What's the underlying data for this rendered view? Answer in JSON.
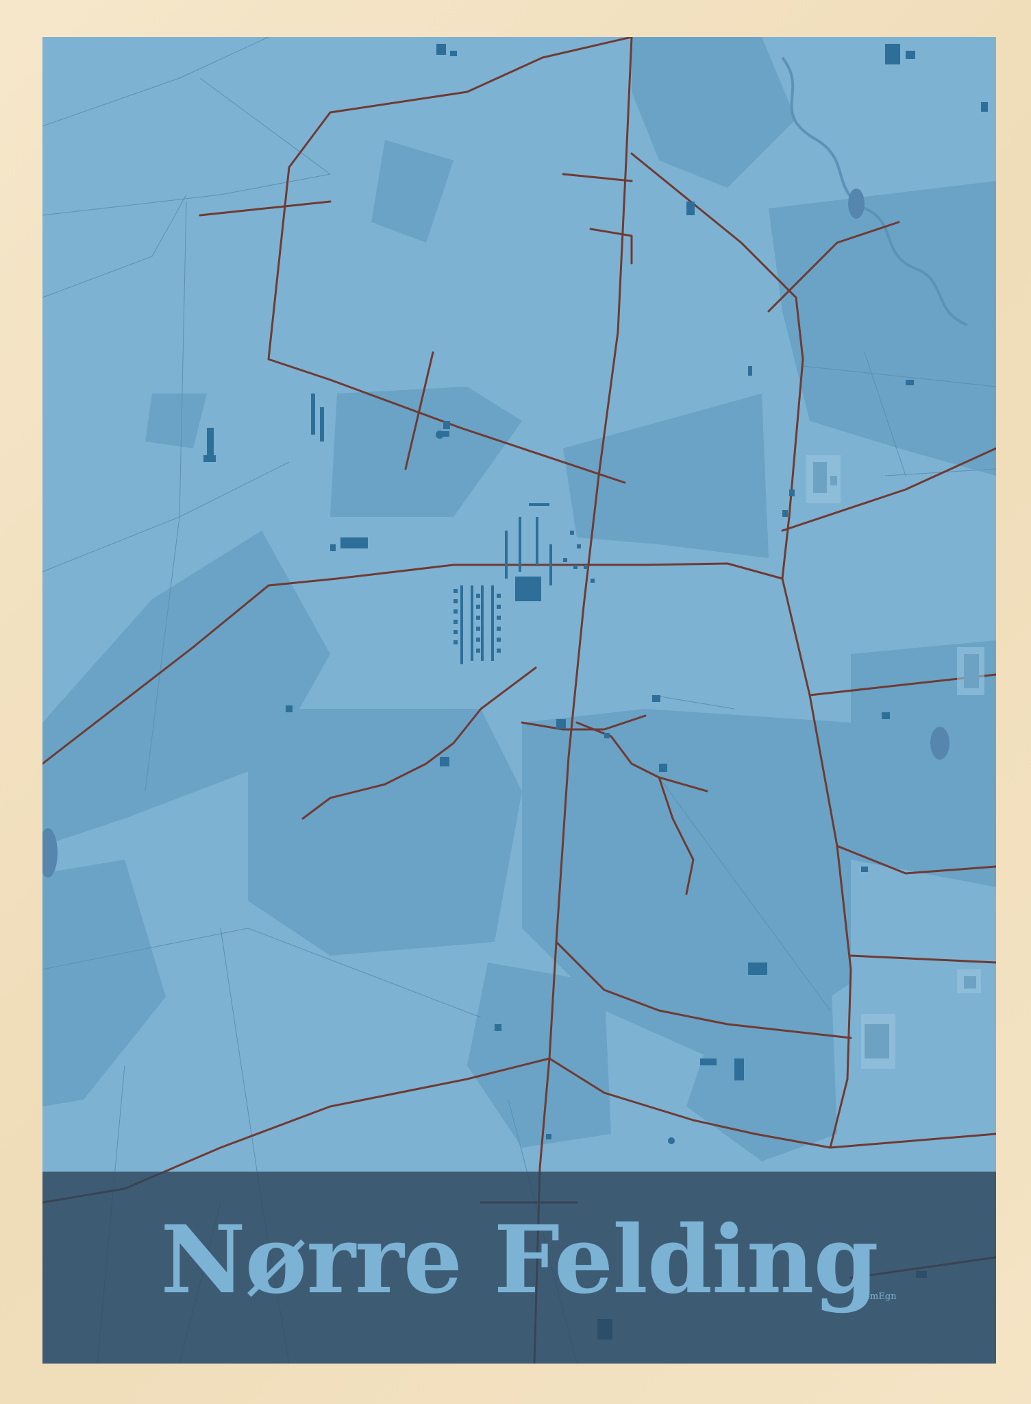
{
  "poster": {
    "title": "Nørre Felding",
    "logo": "HjemEgn"
  },
  "colors": {
    "frame": "#f3e3c6",
    "land_light": "#7eb2d2",
    "land_dark": "#6aa3c6",
    "buildings": "#2d6f98",
    "roads": "#6e3b33",
    "water": "#5686ad",
    "band": "#2d465c",
    "title": "#7cb2d4"
  }
}
